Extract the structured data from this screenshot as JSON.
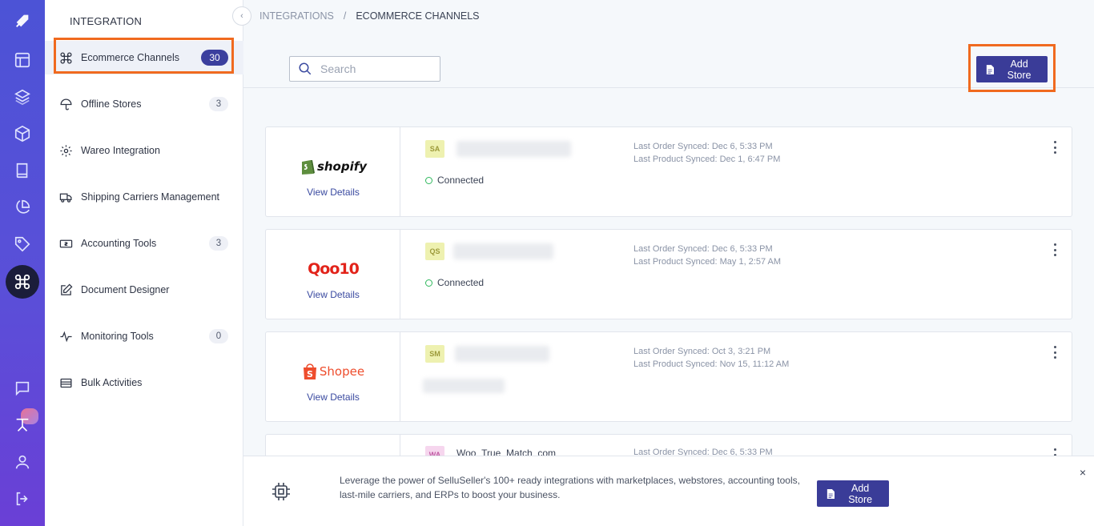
{
  "sidebar": {
    "title": "INTEGRATION",
    "items": [
      {
        "label": "Ecommerce Channels",
        "count": "30"
      },
      {
        "label": "Offline Stores",
        "count": "3"
      },
      {
        "label": "Wareo Integration",
        "count": ""
      },
      {
        "label": "Shipping Carriers Management",
        "count": ""
      },
      {
        "label": "Accounting Tools",
        "count": "3"
      },
      {
        "label": "Document Designer",
        "count": ""
      },
      {
        "label": "Monitoring Tools",
        "count": "0"
      },
      {
        "label": "Bulk Activities",
        "count": ""
      }
    ]
  },
  "breadcrumb": {
    "root": "INTEGRATIONS",
    "separator": "/",
    "current": "ECOMMERCE CHANNELS"
  },
  "search": {
    "placeholder": "Search"
  },
  "toolbar": {
    "add_store_label": "Add Store"
  },
  "cards": [
    {
      "platform": "shopify",
      "view_details": "View Details",
      "initials": "SA",
      "status": "Connected",
      "last_order": "Last Order Synced:  Dec 6, 5:33 PM",
      "last_product": "Last Product Synced:  Dec 1, 6:47 PM"
    },
    {
      "platform": "Qoo10",
      "view_details": "View Details",
      "initials": "QS",
      "status": "Connected",
      "last_order": "Last Order Synced:  Dec 6, 5:33 PM",
      "last_product": "Last Product Synced:  May 1, 2:57 AM"
    },
    {
      "platform": "Shopee",
      "view_details": "View Details",
      "initials": "SM",
      "status": "",
      "last_order": "Last Order Synced:  Oct 3, 3:21 PM",
      "last_product": "Last Product Synced:  Nov 15, 11:12 AM"
    },
    {
      "platform": "",
      "view_details": "",
      "initials": "WA",
      "store_name": "Woo_True_Match_com",
      "last_order": "Last Order Synced:  Dec 6, 5:33 PM"
    }
  ],
  "banner": {
    "text": "Leverage the power of SelluSeller's 100+ ready integrations with marketplaces, webstores, accounting tools, last-mile carriers, and ERPs to boost your business.",
    "button_label": "Add Store",
    "close": "×"
  },
  "colors": {
    "rail": "#4c53d6",
    "primary_button": "#3a3c98",
    "highlight": "#f06a1f",
    "connected": "#2eb85c",
    "link": "#3a4aa0"
  }
}
